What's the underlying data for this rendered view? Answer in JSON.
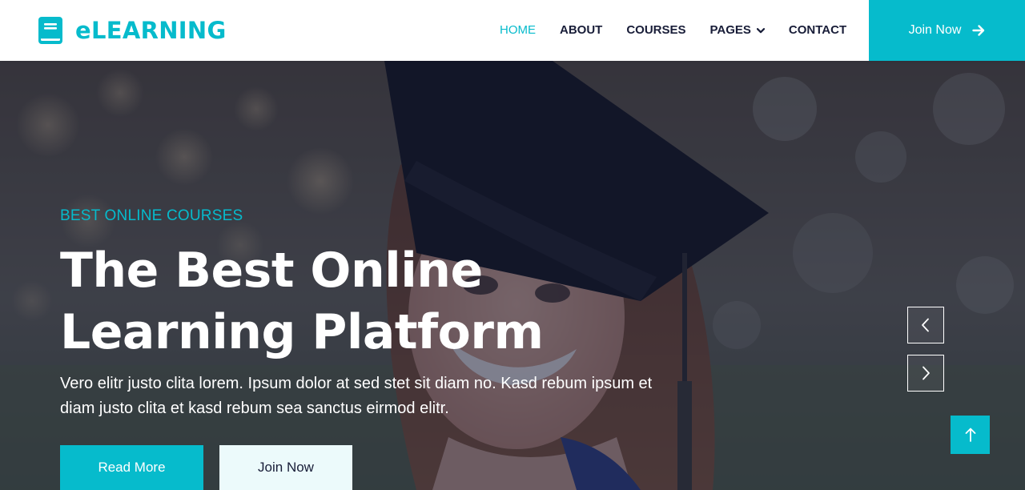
{
  "brand": {
    "name": "eLEARNING",
    "icon": "book-icon"
  },
  "nav": {
    "items": [
      {
        "label": "HOME",
        "active": true
      },
      {
        "label": "ABOUT",
        "active": false
      },
      {
        "label": "COURSES",
        "active": false
      },
      {
        "label": "PAGES",
        "active": false,
        "has_dropdown": true,
        "icon": "chevron-down-icon"
      },
      {
        "label": "CONTACT",
        "active": false
      }
    ],
    "cta": {
      "label": "Join Now",
      "icon": "arrow-right-icon"
    }
  },
  "hero": {
    "eyebrow": "BEST ONLINE COURSES",
    "title_line1": "The Best Online",
    "title_line2": "Learning Platform",
    "description": "Vero elitr justo clita lorem. Ipsum dolor at sed stet sit diam no. Kasd rebum ipsum et diam justo clita et kasd rebum sea sanctus eirmod elitr.",
    "primary_button": "Read More",
    "secondary_button": "Join Now",
    "carousel_prev_icon": "chevron-left-icon",
    "carousel_next_icon": "chevron-right-icon"
  },
  "back_to_top": {
    "icon": "arrow-up-icon"
  },
  "colors": {
    "primary": "#06BBCC",
    "dark": "#181d38",
    "light": "#ecfafb",
    "white": "#ffffff"
  }
}
